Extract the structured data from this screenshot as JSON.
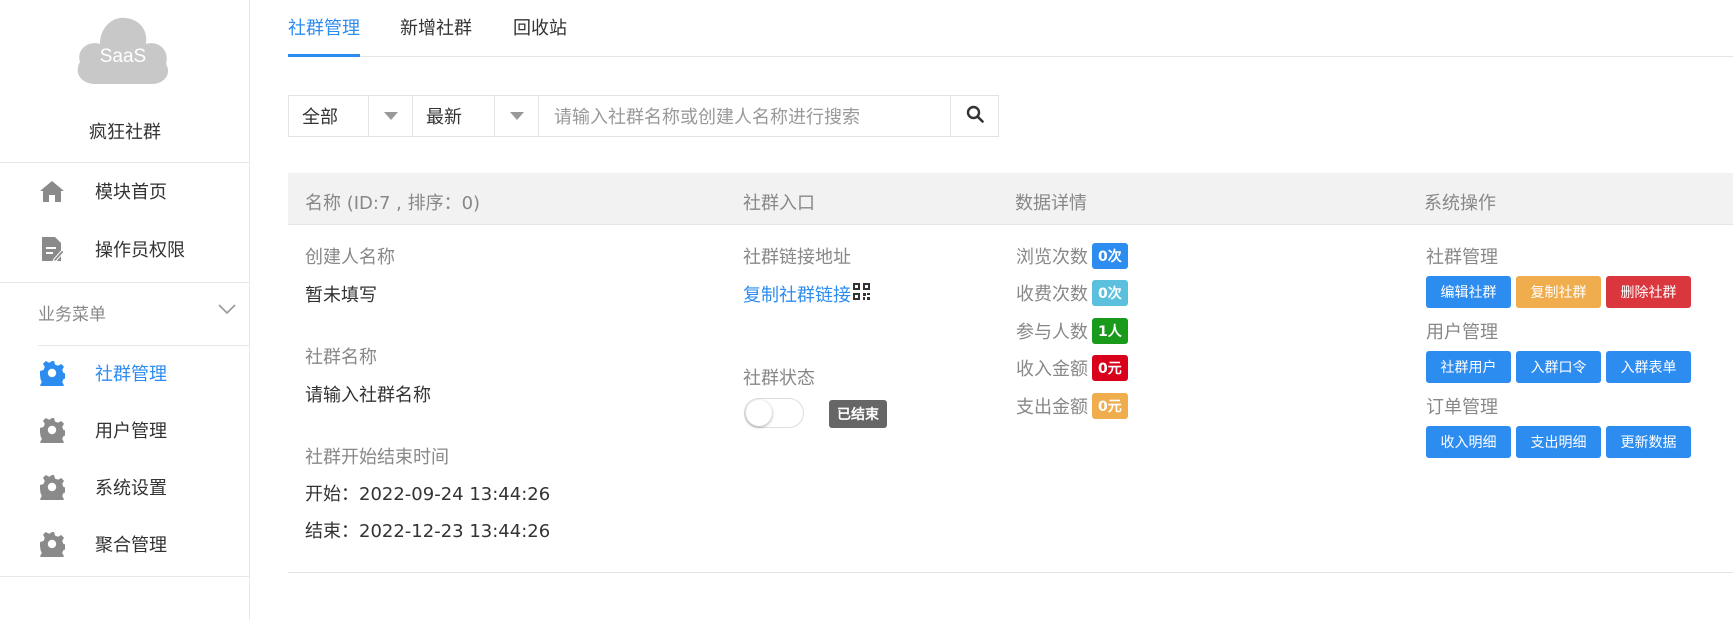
{
  "sidebar": {
    "logo_text": "SaaS",
    "brand": "疯狂社群",
    "top_items": [
      {
        "label": "模块首页",
        "icon": "home-icon"
      },
      {
        "label": "操作员权限",
        "icon": "document-edit-icon"
      }
    ],
    "section_title": "业务菜单",
    "menu_items": [
      {
        "label": "社群管理",
        "icon": "gear-icon",
        "active": true
      },
      {
        "label": "用户管理",
        "icon": "gear-icon"
      },
      {
        "label": "系统设置",
        "icon": "gear-icon"
      },
      {
        "label": "聚合管理",
        "icon": "gear-icon"
      }
    ]
  },
  "tabs": [
    "社群管理",
    "新增社群",
    "回收站"
  ],
  "filters": {
    "type_value": "全部",
    "sort_value": "最新",
    "search_placeholder": "请输入社群名称或创建人名称进行搜索"
  },
  "table": {
    "headers": {
      "name": "名称 (ID:7 , 排序：0)",
      "entry": "社群入口",
      "stats": "数据详情",
      "ops": "系统操作"
    },
    "row": {
      "creator_label": "创建人名称",
      "creator_value": "暂未填写",
      "group_name_label": "社群名称",
      "group_name_value": "请输入社群名称",
      "time_label": "社群开始结束时间",
      "start": "开始：2022-09-24 13:44:26",
      "end": "结束：2022-12-23 13:44:26",
      "link_label": "社群链接地址",
      "link_text": "复制社群链接",
      "status_label": "社群状态",
      "status_value": "已结束",
      "stats": [
        {
          "label": "浏览次数",
          "value": "0次",
          "color": "#2d8cf0"
        },
        {
          "label": "收费次数",
          "value": "0次",
          "color": "#5bc0de"
        },
        {
          "label": "参与人数",
          "value": "1人",
          "color": "#1a9a1a"
        },
        {
          "label": "收入金额",
          "value": "0元",
          "color": "#d9001b"
        },
        {
          "label": "支出金额",
          "value": "0元",
          "color": "#f0ad4e"
        }
      ],
      "ops_groups": [
        {
          "title": "社群管理",
          "buttons": [
            {
              "label": "编辑社群",
              "color": "#2d8cf0"
            },
            {
              "label": "复制社群",
              "color": "#f0ad4e"
            },
            {
              "label": "删除社群",
              "color": "#d9363e"
            }
          ]
        },
        {
          "title": "用户管理",
          "buttons": [
            {
              "label": "社群用户",
              "color": "#2d8cf0"
            },
            {
              "label": "入群口令",
              "color": "#2d8cf0"
            },
            {
              "label": "入群表单",
              "color": "#2d8cf0"
            }
          ]
        },
        {
          "title": "订单管理",
          "buttons": [
            {
              "label": "收入明细",
              "color": "#2d8cf0"
            },
            {
              "label": "支出明细",
              "color": "#2d8cf0"
            },
            {
              "label": "更新数据",
              "color": "#2d8cf0"
            }
          ]
        }
      ]
    }
  }
}
